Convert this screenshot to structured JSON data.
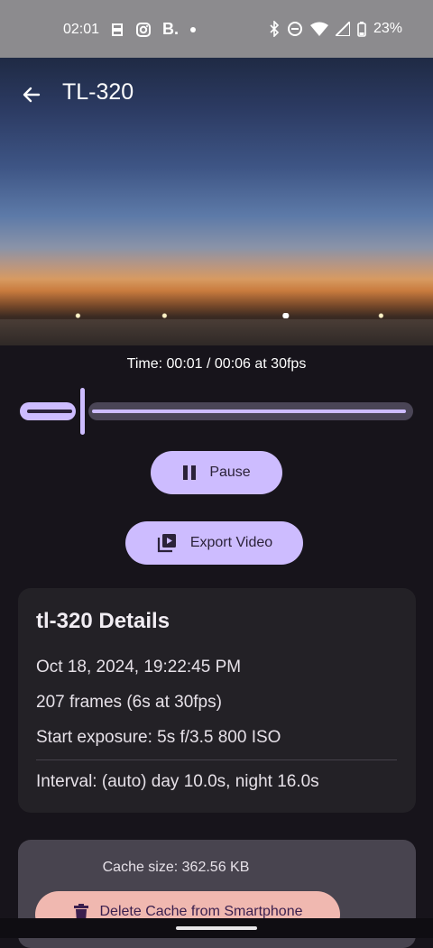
{
  "status_bar": {
    "time": "02:01",
    "brand_letter": "B.",
    "battery": "23%",
    "icons": [
      "authenticator-icon",
      "instagram-icon",
      "dot-icon",
      "bluetooth-icon",
      "dnd-icon",
      "wifi-icon",
      "signal-icon",
      "battery-icon"
    ]
  },
  "app_bar": {
    "title": "TL-320",
    "back_icon": "arrow-left-icon"
  },
  "player": {
    "time_text": "Time: 00:01 / 00:06 at 30fps",
    "progress": 0.17,
    "pause_label": "Pause",
    "export_label": "Export Video"
  },
  "details": {
    "title": "tl-320 Details",
    "date": "Oct 18, 2024, 19:22:45 PM",
    "frames": "207 frames (6s at 30fps)",
    "exposure": "Start exposure: 5s f/3.5 800 ISO",
    "interval": "Interval: (auto) day 10.0s, night 16.0s"
  },
  "cache": {
    "size_text": "Cache size: 362.56 KB",
    "delete_label": "Delete Cache from Smartphone"
  },
  "colors": {
    "accent": "#cdbcff",
    "background": "#17141b",
    "card": "#232126",
    "danger_button": "#f0b8b0"
  }
}
